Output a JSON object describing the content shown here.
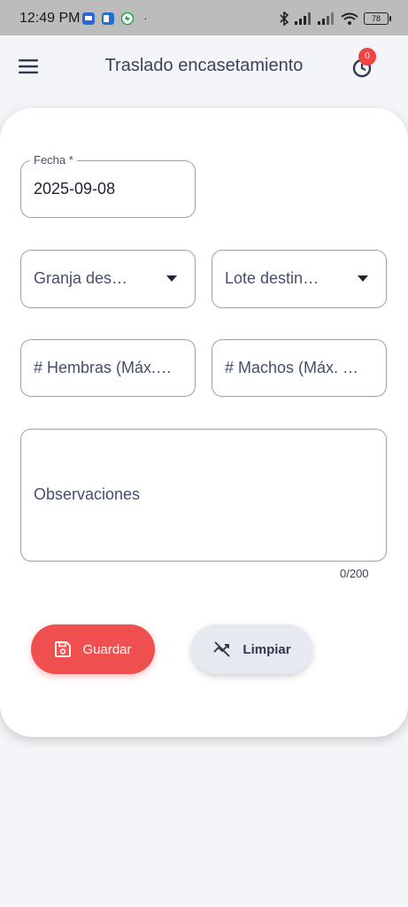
{
  "status_bar": {
    "time": "12:49 PM",
    "dot": "·",
    "battery": "78",
    "icons": [
      "messages-icon",
      "outlook-icon",
      "whatsapp-icon",
      "bluetooth-icon",
      "signal-icon",
      "signal-icon",
      "wifi-icon",
      "battery-icon"
    ]
  },
  "appbar": {
    "title": "Traslado encasetamiento",
    "badge_count": "0",
    "menu_icon": "menu-icon",
    "history_icon": "history-icon"
  },
  "form": {
    "fecha": {
      "label": "Fecha *",
      "value": "2025-09-08"
    },
    "granja_destino": {
      "placeholder": "Granja des…"
    },
    "lote_destino": {
      "placeholder": "Lote destin…"
    },
    "hembras": {
      "placeholder": "# Hembras (Máx.…"
    },
    "machos": {
      "placeholder": "# Machos (Máx. …"
    },
    "observaciones": {
      "placeholder": "Observaciones",
      "counter": "0/200"
    }
  },
  "buttons": {
    "save_label": "Guardar",
    "clear_label": "Limpiar",
    "save_icon": "save-icon",
    "clear_icon": "clear-icon"
  },
  "colors": {
    "accent": "#f04f4f",
    "badge": "#ef4444",
    "secondary_button": "#e7e9f0",
    "background": "#f4f5f8"
  }
}
